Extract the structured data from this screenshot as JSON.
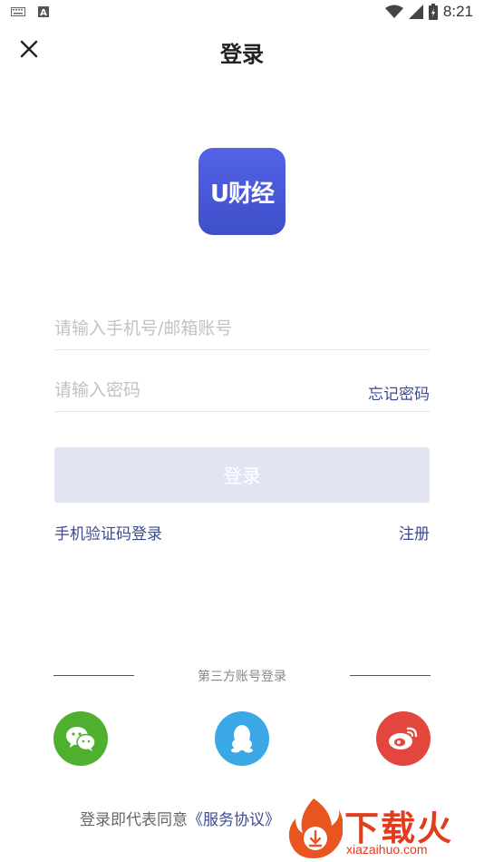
{
  "status_bar": {
    "time": "8:21",
    "left_icons": [
      "keyboard-icon",
      "a-notification-icon"
    ],
    "right_icons": [
      "wifi-icon",
      "signal-icon",
      "battery-icon"
    ]
  },
  "header": {
    "title": "登录",
    "close_icon": "close-icon"
  },
  "logo": {
    "text": "U财经",
    "color": "#4f5ee0"
  },
  "form": {
    "account_placeholder": "请输入手机号/邮箱账号",
    "password_placeholder": "请输入密码",
    "forgot_label": "忘记密码",
    "login_label": "登录",
    "sms_login_label": "手机验证码登录",
    "register_label": "注册"
  },
  "third_party": {
    "title": "第三方账号登录",
    "providers": [
      {
        "icon": "wechat-icon",
        "color": "#4fb02f"
      },
      {
        "icon": "qq-icon",
        "color": "#3aa8e4"
      },
      {
        "icon": "weibo-icon",
        "color": "#e2463c"
      }
    ]
  },
  "agreement": {
    "prefix": "登录即代表同意",
    "link": "《服务协议》"
  },
  "watermark": {
    "text": "下载火",
    "sub": "xiazaihuo.com"
  },
  "colors": {
    "accent": "#3c4a8f",
    "button_disabled": "#e2e4f4"
  }
}
